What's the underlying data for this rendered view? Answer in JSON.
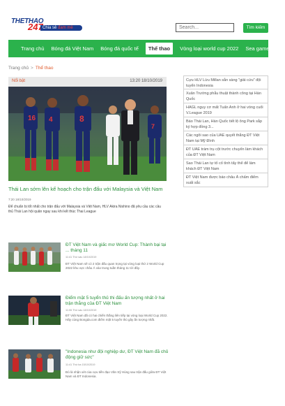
{
  "header": {
    "logo": {
      "top": "THETHAO",
      "num": "247",
      "tag_a": "Chia sẻ ",
      "tag_b": "đam mê"
    },
    "search": {
      "placeholder": "Search...",
      "button": "Tìm kiếm"
    }
  },
  "nav": {
    "items": [
      "Trang chủ",
      "Bóng đá Việt Nam",
      "Bóng đá quốc tế",
      "Thể thao",
      "Vòng loại world cup 2022",
      "Sea games 30"
    ],
    "active_index": 3
  },
  "breadcrumb": {
    "home": "Trang chủ",
    "separator": ">",
    "current": "Thể thao"
  },
  "featured": {
    "badge": "Nổi bật",
    "time": "13:20 18/10/2019",
    "title": "Thái Lan sớm lên kế hoạch cho trận đấu với Malaysia và Việt Nam",
    "date": "7:20 18/10/2019",
    "desc": "Để chuẩn bị tốt nhất cho trận đấu với Malaysia và Việt Nam, HLV Akira Nishino đã yêu cầu các cầu thủ Thái Lan hội quân ngay sau khi kết thúc Thai League",
    "player_numbers": [
      "16",
      "4",
      "8",
      "7"
    ]
  },
  "sidebar": {
    "items": [
      "Cựu HLV Lừu Millan sẵn sàng \"giải cứu\" đội tuyển Indonesia",
      "Xuân Trường phẫu thuật thành công tại Hàn Quốc",
      "HAGL nguy cơ mất Tuấn Anh ở hai vòng cuối V.League 2019",
      "Báo Thái Lan, Hàn Quốc tiết lộ ông Park sắp ký hợp đồng 3...",
      "Các ngôi sao của UAE quyết thắng ĐT Việt Nam tại Mỹ Đình",
      "ĐT UAE trám trụ cột trước chuyến làm khách của ĐT Việt Nam",
      "Sao Thái Lan tự tố cố tình tẩy thể để làm khách ĐT Việt Nam",
      "ĐT Việt Nam được báo châu Á chấm điểm xuất sắc"
    ]
  },
  "articles": [
    {
      "title": "ĐT Việt Nam và giấc mơ World Cup: Thành bại tại ... tháng 11",
      "date": "11:41 Thứ sáu 18/10/2019",
      "desc": "ĐT Việt Nam sẽ có 2 trận đấu quan trọng tại vòng loại thứ 2 World Cup 2022 khu vực châu Á vào trung tuần tháng 11 tới đây."
    },
    {
      "title": "Điểm mặt 5 tuyển thủ thi đấu ấn tượng nhất ở hai trận thắng của ĐT Việt Nam",
      "date": "11:06 Thứ sáu 18/10/2019",
      "desc": "ĐT Việt Nam đã có hai chiến thắng liên tiếp tại vòng loại World Cup 2022. Hãy cùng Bongda.com điểm mặt 5 tuyển thủ gây ấn tượng nhất."
    },
    {
      "title": "\"Indonesia như đội nghiệp dư, ĐT Việt Nam đã chủ động giữ sức\"",
      "date": "11:41 Thứ ba 15/10/2019",
      "desc": "Đó là nhận xét của cựu tiền đạo Văn Sỹ Hùng sau trận đấu giữa ĐT Việt Nam và ĐT Indonesia."
    }
  ]
}
